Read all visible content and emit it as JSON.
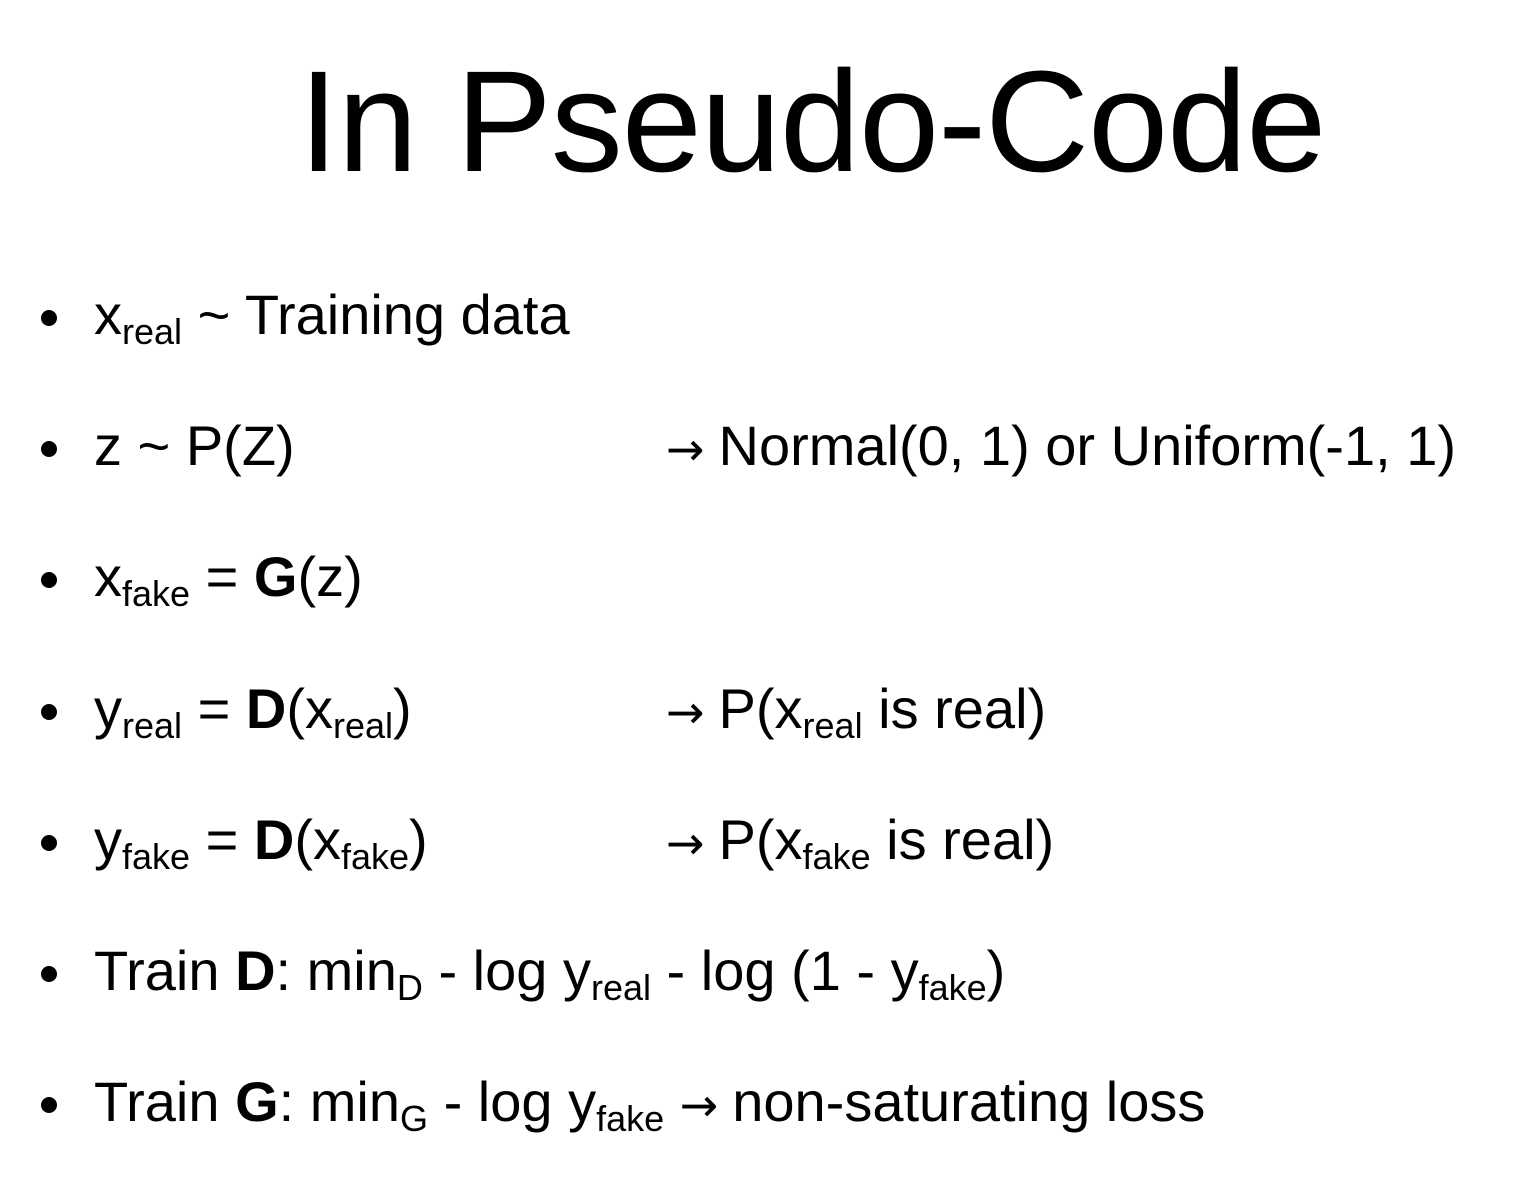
{
  "title": "In Pseudo-Code",
  "bullets": [
    {
      "x": "x",
      "x_sub": "real",
      "rest": " ~ Training data"
    },
    {
      "left": "z ~ P(Z)",
      "arrow": "→",
      "right": "Normal(0, 1) or Uniform(-1, 1)"
    },
    {
      "x": "x",
      "x_sub": "fake",
      "eq": " = ",
      "fn": "G",
      "arg": "(z)"
    },
    {
      "y": "y",
      "y_sub": "real",
      "eq": " = ",
      "fn": "D",
      "open": "(x",
      "arg_sub": "real",
      "close": ")",
      "arrow": "→",
      "r_pre": "P(x",
      "r_sub": "real",
      "r_post": " is real)"
    },
    {
      "y": "y",
      "y_sub": "fake",
      "eq": " = ",
      "fn": "D",
      "open": "(x",
      "arg_sub": "fake",
      "close": ")",
      "arrow": "→",
      "r_pre": "P(x",
      "r_sub": "fake",
      "r_post": " is real)"
    },
    {
      "train": "Train ",
      "fn": "D",
      "colon": ": min",
      "min_sub": "D",
      "p1": " - log y",
      "p1_sub": "real",
      "p2": " - log (1 - y",
      "p2_sub": "fake",
      "p3": ")"
    },
    {
      "train": "Train ",
      "fn": "G",
      "colon": ": min",
      "min_sub": "G",
      "p1": " - log y",
      "p1_sub": "fake",
      "arrow": "→",
      "rest": "non-saturating loss"
    }
  ]
}
